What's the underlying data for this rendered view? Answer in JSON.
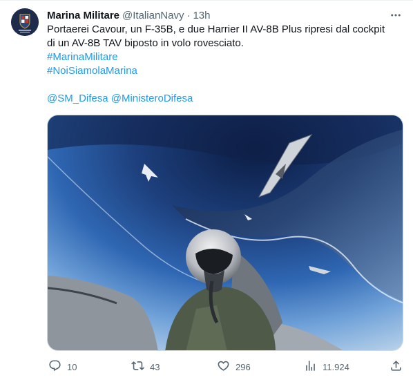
{
  "tweet": {
    "author_name": "Marina Militare",
    "handle": "@ItalianNavy",
    "separator": "·",
    "time": "13h",
    "text_line1": "Portaerei Cavour, un F-35B, e due Harrier II AV-8B Plus ripresi dal cockpit",
    "text_line2": "di un AV-8B TAV biposto in volo rovesciato.",
    "hashtag1": "#MarinaMilitare",
    "hashtag2": "#NoiSiamolaMarina",
    "mentions": "@SM_Difesa @MinisteroDifesa",
    "avatar_text": "MARINA MILITARE"
  },
  "actions": {
    "replies": "10",
    "retweets": "43",
    "likes": "296",
    "views": "11.924"
  },
  "colors": {
    "link": "#1d9bf0",
    "muted": "#536471",
    "text": "#0f1419"
  },
  "icons": [
    "avatar",
    "more-icon",
    "reply-icon",
    "retweet-icon",
    "like-icon",
    "views-icon",
    "share-icon"
  ]
}
